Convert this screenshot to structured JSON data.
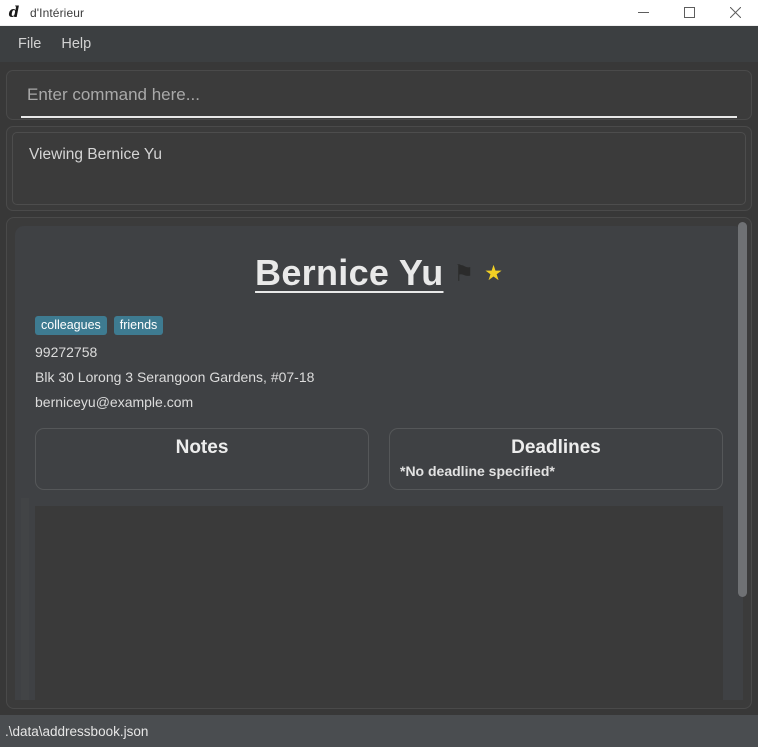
{
  "window": {
    "logo_glyph": "d",
    "logo_icon_name": "app-logo-icon",
    "title": "d'Intérieur",
    "minimize_label": "Minimize",
    "maximize_label": "Maximize",
    "close_label": "Close"
  },
  "menubar": {
    "items": [
      {
        "label": "File"
      },
      {
        "label": "Help"
      }
    ]
  },
  "command": {
    "placeholder": "Enter command here...",
    "value": ""
  },
  "result": {
    "text": "Viewing Bernice Yu"
  },
  "person": {
    "name": "Bernice Yu",
    "flag_icon": "⚑",
    "star_icon": "★",
    "tags": [
      "colleagues",
      "friends"
    ],
    "phone": "99272758",
    "address": "Blk 30 Lorong 3 Serangoon Gardens, #07-18",
    "email": "berniceyu@example.com"
  },
  "panels": {
    "notes": {
      "title": "Notes",
      "body": ""
    },
    "deadlines": {
      "title": "Deadlines",
      "body": "*No deadline specified*"
    }
  },
  "statusbar": {
    "path": ".\\data\\addressbook.json"
  },
  "colors": {
    "window_bg": "#383838",
    "panel_bg": "#3b3b3b",
    "card_bg": "#3f4144",
    "menubar_bg": "#3c3f41",
    "statusbar_bg": "#4a4d50",
    "tag_bg": "#3e7b91",
    "star": "#f2d024",
    "text": "#dcdcdc",
    "scrollbar_thumb": "#6f7174"
  }
}
